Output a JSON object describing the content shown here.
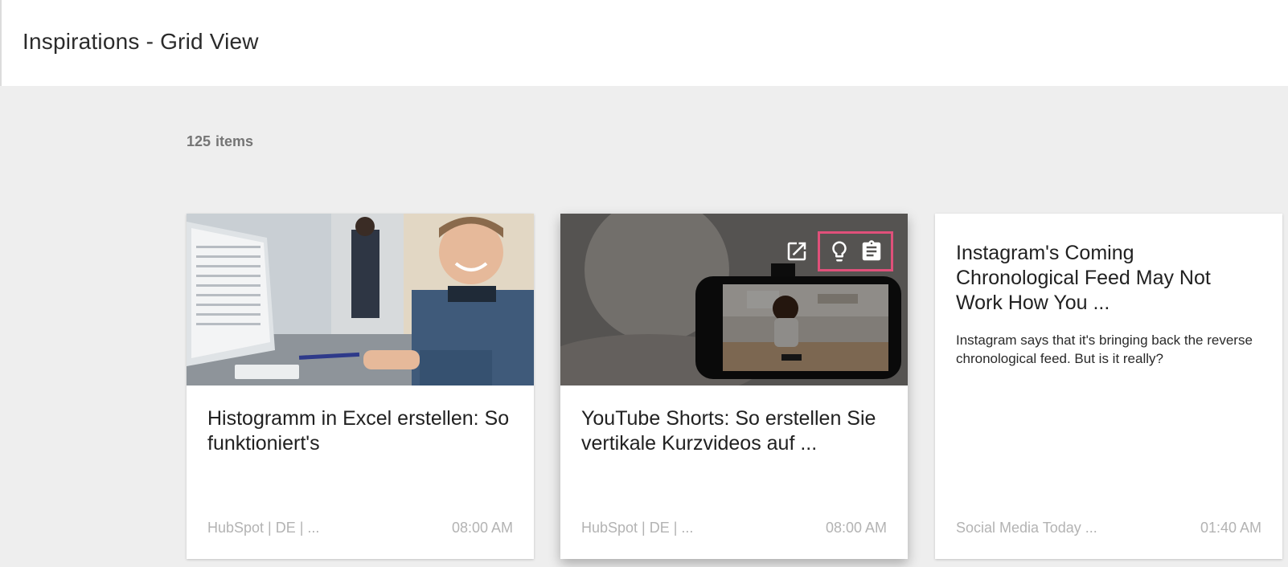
{
  "page": {
    "title": "Inspirations - Grid View"
  },
  "summary": {
    "count": "125",
    "unit": "items"
  },
  "cards": [
    {
      "title": "Histogramm in Excel erstellen: So funktioniert's",
      "description": "",
      "source": "HubSpot | DE | ...",
      "time": "08:00 AM",
      "has_image": true
    },
    {
      "title": "YouTube Shorts: So erstellen Sie vertikale Kurzvideos auf ...",
      "description": "",
      "source": "HubSpot | DE | ...",
      "time": "08:00 AM",
      "has_image": true,
      "actions": [
        {
          "icon": "open-external-icon"
        },
        {
          "icon": "lightbulb-icon"
        },
        {
          "icon": "clipboard-icon"
        }
      ]
    },
    {
      "title": "Instagram's Coming Chronological Feed May Not Work How You ...",
      "description": "Instagram says that it's bringing back the reverse chronological feed. But is it really?",
      "source": "Social Media Today ...",
      "time": "01:40 AM",
      "has_image": false
    }
  ],
  "colors": {
    "background": "#eeeeee",
    "highlight": "#e0507a",
    "meta_text": "#b3b3b3"
  }
}
